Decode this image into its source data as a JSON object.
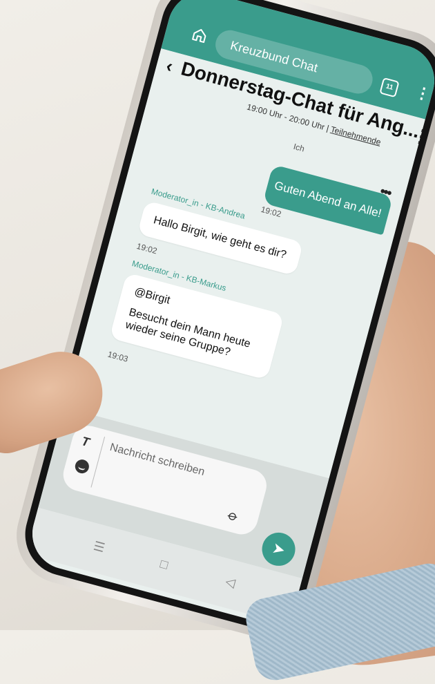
{
  "app": {
    "title": "Kreuzbund Chat",
    "calendar_badge": "11"
  },
  "chat": {
    "title": "Donnerstag-Chat für Ang...",
    "time_range": "19:00 Uhr - 20:00 Uhr",
    "separator": "|",
    "participants_link": "Teilnehmende"
  },
  "messages": [
    {
      "sender": "Ich",
      "text": "Guten Abend an Alle!",
      "time": "19:02",
      "outgoing": true
    },
    {
      "sender": "Moderator_in - KB-Andrea",
      "text": "Hallo Birgit, wie geht es dir?",
      "time": "19:02",
      "outgoing": false
    },
    {
      "sender": "Moderator_in - KB-Markus",
      "mention": "@Birgit",
      "text": "Besucht dein Mann heute wieder seine Gruppe?",
      "time": "19:03",
      "outgoing": false
    }
  ],
  "composer": {
    "placeholder": "Nachricht schreiben"
  },
  "icons": {
    "home": "home-icon",
    "calendar": "calendar-icon",
    "more": "more-vertical-icon",
    "back": "chevron-left-icon",
    "format": "text-format-icon",
    "emoji": "emoji-icon",
    "attach": "paperclip-icon",
    "send": "send-icon"
  },
  "colors": {
    "accent": "#3a9c8c",
    "background": "#e9f0ee",
    "bubble_in": "#ffffff"
  }
}
